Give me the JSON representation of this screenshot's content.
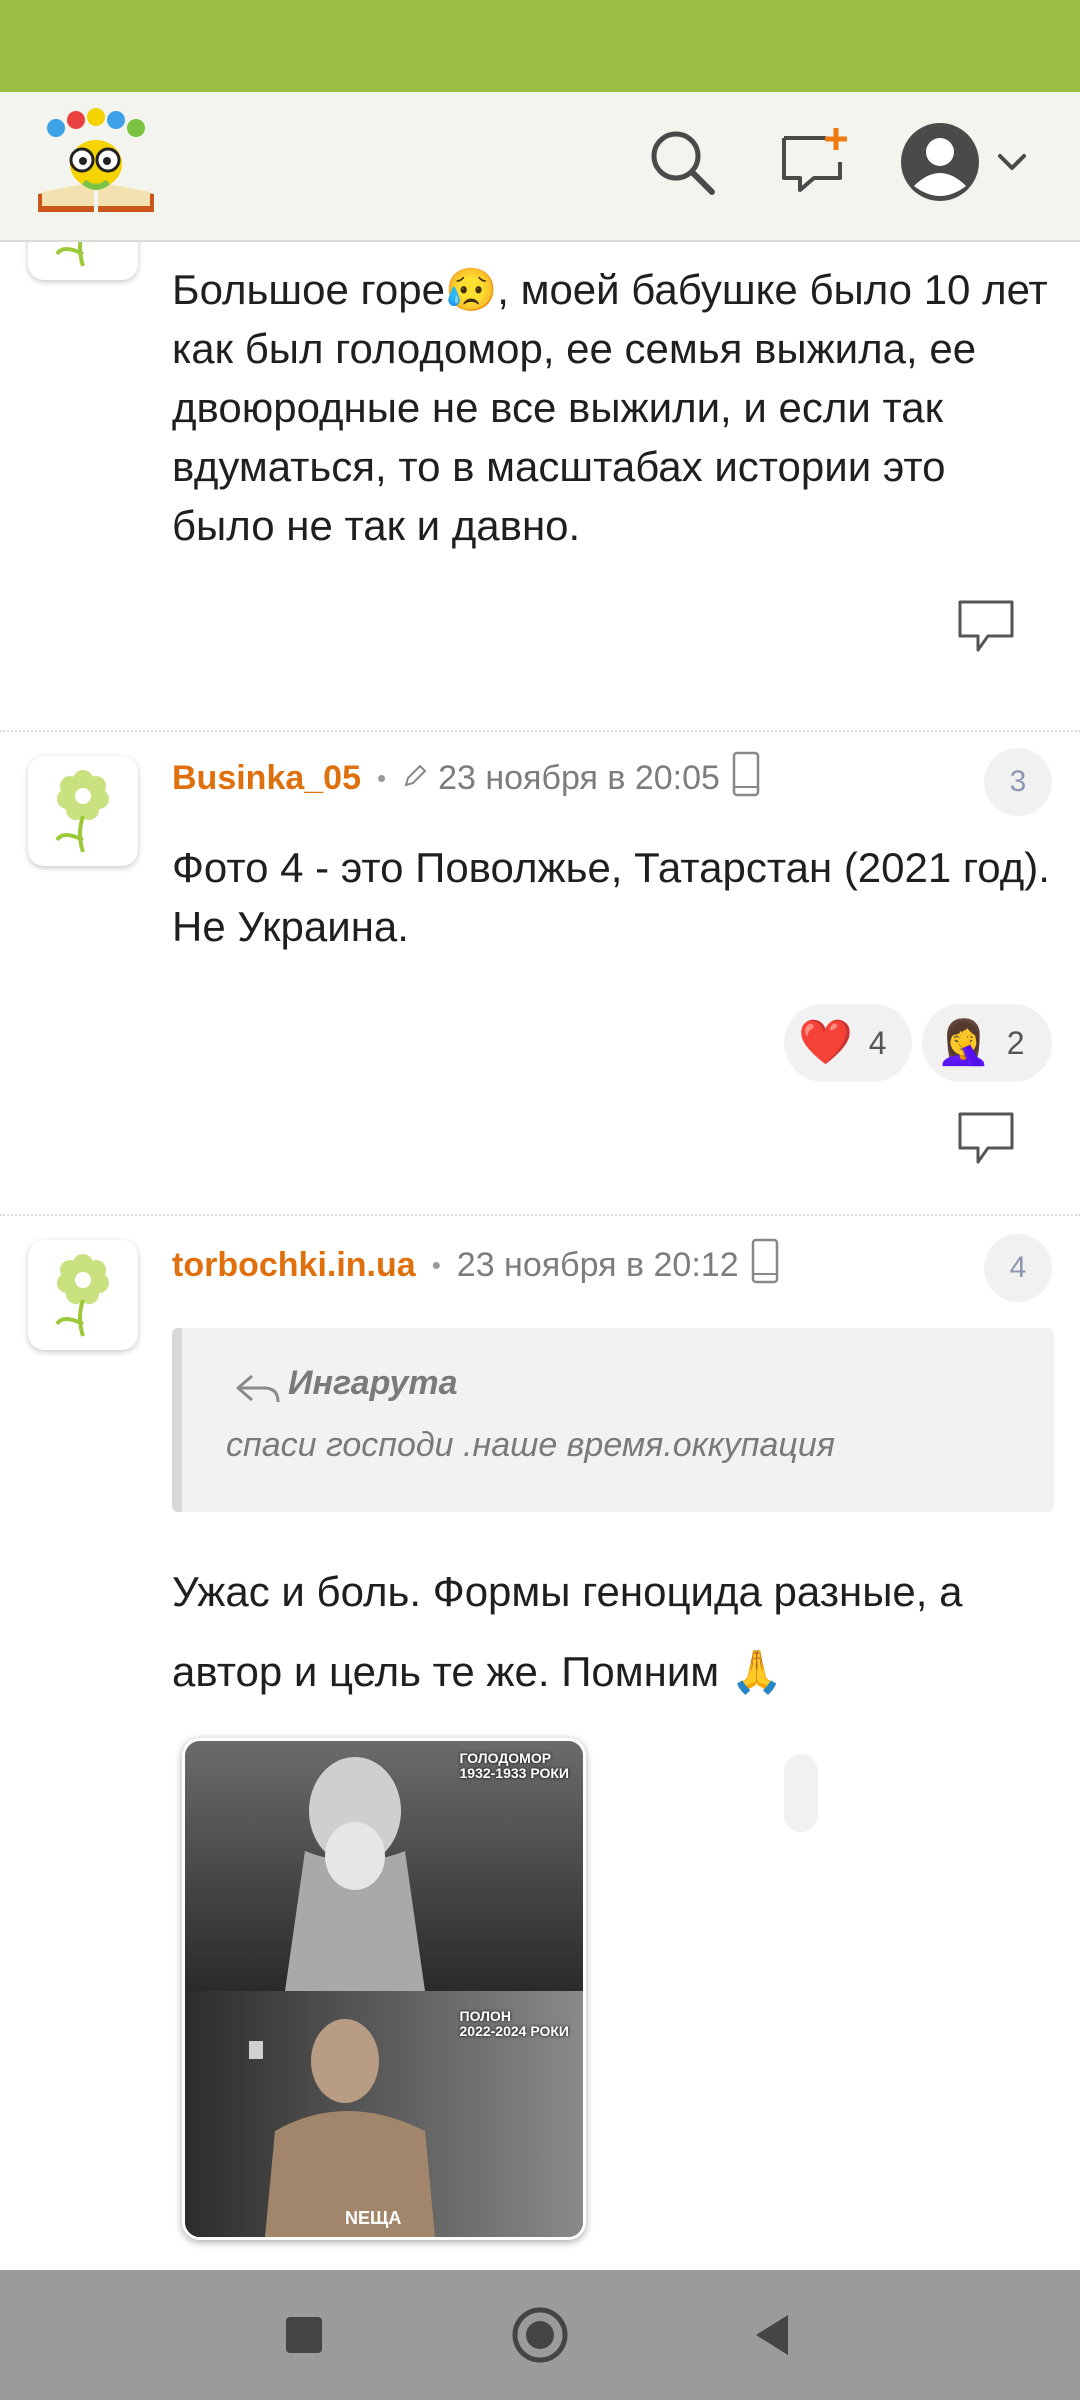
{
  "header": {
    "logo_alt": "site-logo",
    "search_icon": "search-icon",
    "new_post_icon": "new-post-icon",
    "avatar_icon": "user-avatar-icon",
    "dropdown_icon": "chevron-down-icon"
  },
  "comments": [
    {
      "text": "Большое горе😥, моей бабушке было 10 лет как был голодомор, ее семья выжила, ее двоюродные не все выжили, и если так вдуматься, то в масштабах истории это было не так и давно."
    },
    {
      "author": "Businka_05",
      "date": "23 ноября в 20:05",
      "number": "3",
      "text": "Фото 4 - это Поволжье, Татарстан (2021 год). Не Украина.",
      "reactions": [
        {
          "emoji": "❤️",
          "count": "4"
        },
        {
          "emoji": "🤦‍♀️",
          "count": "2"
        }
      ]
    },
    {
      "author": "torbochki.in.ua",
      "date": "23 ноября в 20:12",
      "number": "4",
      "quote_author": "Ингарута",
      "quote_text": "спаси господи .наше время.оккупация",
      "text": "Ужас и боль. Формы геноцида разные, а автор и цель те же. Помним 🙏",
      "image": {
        "top_caption_1": "ГОЛОДОМОР",
        "top_caption_2": "1932-1933 РОКИ",
        "bottom_caption_1": "ПОЛОН",
        "bottom_caption_2": "2022-2024 РОКИ",
        "logo": "NEЩA"
      }
    }
  ],
  "colors": {
    "status_bar": "#9cbf44",
    "author": "#e0700d",
    "nav_bar": "#9b9b9b"
  }
}
